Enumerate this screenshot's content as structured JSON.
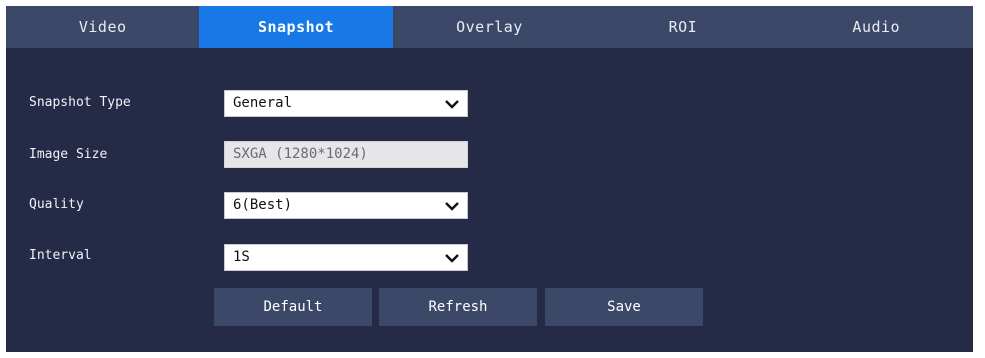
{
  "tabs": [
    {
      "label": "Video",
      "active": false
    },
    {
      "label": "Snapshot",
      "active": true
    },
    {
      "label": "Overlay",
      "active": false
    },
    {
      "label": "ROI",
      "active": false
    },
    {
      "label": "Audio",
      "active": false
    }
  ],
  "form": {
    "snapshot_type": {
      "label": "Snapshot Type",
      "value": "General"
    },
    "image_size": {
      "label": "Image Size",
      "value": "SXGA (1280*1024)"
    },
    "quality": {
      "label": "Quality",
      "value": "6(Best)"
    },
    "interval": {
      "label": "Interval",
      "value": "1S"
    }
  },
  "buttons": {
    "default": "Default",
    "refresh": "Refresh",
    "save": "Save"
  },
  "colors": {
    "panel_bg": "#252b47",
    "tab_bg": "#3c4868",
    "tab_active": "#1778e6",
    "button_bg": "#3c4868"
  }
}
